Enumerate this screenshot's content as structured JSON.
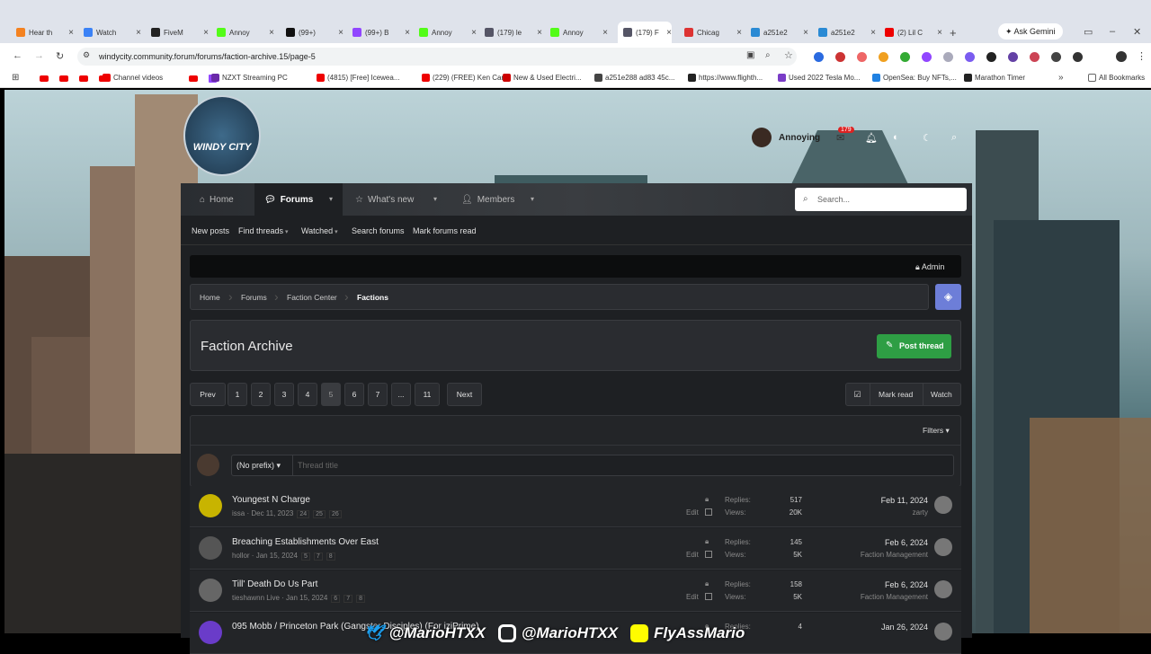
{
  "browser": {
    "tabs": [
      {
        "label": "Hear th",
        "color": "#f48220"
      },
      {
        "label": "Watch",
        "color": "#3b82f6"
      },
      {
        "label": "FiveM",
        "color": "#222"
      },
      {
        "label": "Annoy",
        "color": "#53fc18"
      },
      {
        "label": "(99+)",
        "color": "#111"
      },
      {
        "label": "(99+) B",
        "color": "#9146ff"
      },
      {
        "label": "Annoy",
        "color": "#53fc18"
      },
      {
        "label": "(179) le",
        "color": "#556"
      },
      {
        "label": "Annoy",
        "color": "#53fc18"
      },
      {
        "label": "(179) F",
        "color": "#556"
      },
      {
        "label": "Chicag",
        "color": "#d33"
      },
      {
        "label": "a251e2",
        "color": "#2a8ad4"
      },
      {
        "label": "a251e2",
        "color": "#2a8ad4"
      },
      {
        "label": "(2) Lil C",
        "color": "#e00"
      }
    ],
    "ask_gemini": "Ask Gemini",
    "url": "windycity.community.forum/forums/faction-archive.15/page-5",
    "bookmarks": [
      {
        "label": "Channel videos",
        "color": "#e00"
      },
      {
        "label": "NZXT Streaming PC",
        "color": "#6a2aa8"
      },
      {
        "label": "(4815) [Free] Icewea...",
        "color": "#e00"
      },
      {
        "label": "(229) (FREE) Ken Car...",
        "color": "#e00"
      },
      {
        "label": "New & Used Electri...",
        "color": "#c00"
      },
      {
        "label": "a251e288 ad83 45c...",
        "color": "#444"
      },
      {
        "label": "https://www.flighth...",
        "color": "#222"
      },
      {
        "label": "Used 2022 Tesla Mo...",
        "color": "#7a3cc7"
      },
      {
        "label": "OpenSea: Buy NFTs,...",
        "color": "#2081e2"
      },
      {
        "label": "Marathon Timer",
        "color": "#222"
      }
    ],
    "all_bookmarks": "All Bookmarks"
  },
  "forum": {
    "logo": "WINDY CITY",
    "user": "Annoying",
    "badge": "179",
    "nav": {
      "home": "Home",
      "forums": "Forums",
      "whats_new": "What's new",
      "members": "Members"
    },
    "search_placeholder": "Search...",
    "subnav": [
      "New posts",
      "Find threads",
      "Watched",
      "Search forums",
      "Mark forums read"
    ],
    "admin": "Admin",
    "breadcrumb": [
      "Home",
      "Forums",
      "Faction Center",
      "Factions"
    ],
    "page_title": "Faction Archive",
    "post_thread": "Post thread",
    "pagination": {
      "prev": "Prev",
      "pages": [
        "1",
        "2",
        "3",
        "4",
        "5",
        "6",
        "7",
        "...",
        "11"
      ],
      "next": "Next",
      "current": "5"
    },
    "mark_read": "Mark read",
    "watch": "Watch",
    "filters": "Filters",
    "prefix": "(No prefix)",
    "thread_title_placeholder": "Thread title",
    "replies_label": "Replies:",
    "views_label": "Views:",
    "edit_label": "Edit",
    "threads": [
      {
        "title": "Youngest N Charge",
        "author": "issa",
        "date": "Dec 11, 2023",
        "pages": [
          "24",
          "25",
          "26"
        ],
        "replies": "517",
        "views": "20K",
        "last_date": "Feb 11, 2024",
        "last_by": "zarty",
        "color": "#c8b400"
      },
      {
        "title": "Breaching Establishments Over East",
        "author": "hollor",
        "date": "Jan 15, 2024",
        "pages": [
          "5",
          "7",
          "8"
        ],
        "replies": "145",
        "views": "5K",
        "last_date": "Feb 6, 2024",
        "last_by": "Faction Management",
        "color": "#555"
      },
      {
        "title": "Till' Death Do Us Part",
        "author": "tieshawnn Live",
        "date": "Jan 15, 2024",
        "pages": [
          "6",
          "7",
          "8"
        ],
        "replies": "158",
        "views": "5K",
        "last_date": "Feb 6, 2024",
        "last_by": "Faction Management",
        "color": "#666"
      },
      {
        "title": "095 Mobb / Princeton Park (Gangster Disciples) (For iziPrime)",
        "author": "",
        "date": "",
        "pages": [],
        "replies": "4",
        "views": "",
        "last_date": "Jan 26, 2024",
        "last_by": "",
        "color": "#6a3cc9"
      }
    ]
  },
  "overlay": {
    "twitter": "@MarioHTXX",
    "instagram": "@MarioHTXX",
    "snapchat": "FlyAssMario"
  }
}
